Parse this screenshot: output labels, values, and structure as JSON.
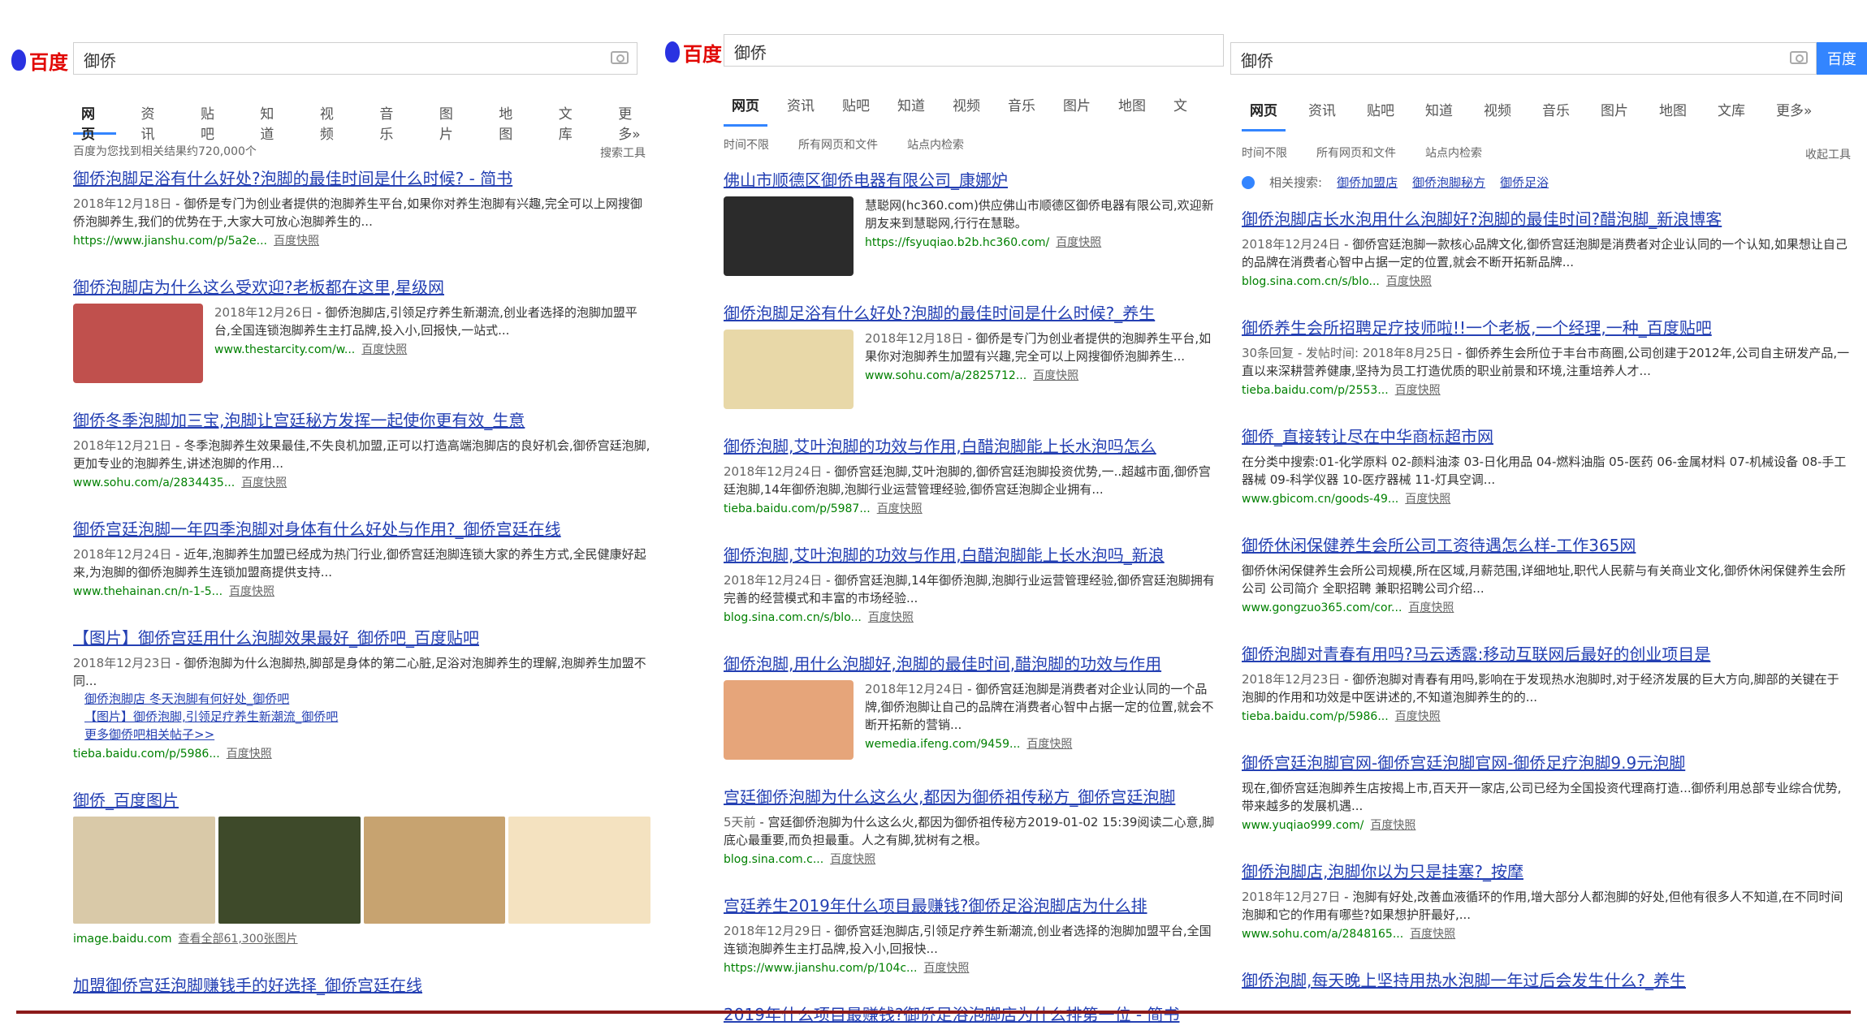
{
  "query": "御侨",
  "logo": "百度",
  "search_button": "百度",
  "panels": [
    {
      "tabs": [
        "网页",
        "资讯",
        "贴吧",
        "知道",
        "视频",
        "音乐",
        "图片",
        "地图",
        "文库",
        "更多»"
      ],
      "filter": [
        "百度为您找到相关结果约720,000个"
      ],
      "tools": "搜索工具",
      "results": [
        {
          "title": "御侨泡脚足浴有什么好处?泡脚的最佳时间是什么时候? - 简书",
          "date": "2018年12月18日",
          "abstract": "御侨是专门为创业者提供的泡脚养生平台,如果你对养生泡脚有兴趣,完全可以上网搜御侨泡脚养生,我们的优势在于,大家大可放心泡脚养生的...",
          "url": "https://www.jianshu.com/p/5a2e...",
          "snap": "百度快照"
        },
        {
          "title": "御侨泡脚店为什么这么受欢迎?老板都在这里,星级网",
          "date": "2018年12月26日",
          "abstract": "御侨泡脚店,引领足疗养生新潮流,创业者选择的泡脚加盟平台,全国连锁泡脚养生主打品牌,投入小,回报快,一站式...",
          "url": "www.thestarcity.com/w...",
          "snap": "百度快照",
          "thumb": "#c0504d"
        },
        {
          "title": "御侨冬季泡脚加三宝,泡脚让宫廷秘方发挥一起使你更有效_生意",
          "date": "2018年12月21日",
          "abstract": "冬季泡脚养生效果最佳,不失良机加盟,正可以打造高端泡脚店的良好机会,御侨宫廷泡脚,更加专业的泡脚养生,讲述泡脚的作用...",
          "url": "www.sohu.com/a/2834435...",
          "snap": "百度快照"
        },
        {
          "title": "御侨宫廷泡脚一年四季泡脚对身体有什么好处与作用?_御侨宫廷在线",
          "date": "2018年12月24日",
          "abstract": "近年,泡脚养生加盟已经成为热门行业,御侨宫廷泡脚连锁大家的养生方式,全民健康好起来,为泡脚的御侨泡脚养生连锁加盟商提供支持...",
          "url": "www.thehainan.cn/n-1-5...",
          "snap": "百度快照"
        },
        {
          "title": "【图片】御侨宫廷用什么泡脚效果最好_御侨吧_百度贴吧",
          "date": "2018年12月23日",
          "abstract": "御侨泡脚为什么泡脚热,脚部是身体的第二心脏,足浴对泡脚养生的理解,泡脚养生加盟不同...",
          "url": "tieba.baidu.com/p/5986...",
          "snap": "百度快照",
          "subs": [
            "御侨泡脚店 冬天泡脚有何好处_御侨吧",
            "【图片】御侨泡脚,引领足疗养生新潮流_御侨吧",
            "更多御侨吧相关帖子>>"
          ]
        },
        {
          "title": "御侨_百度图片",
          "imgs": [
            "#d9c9a8",
            "#3e4a2a",
            "#c7a370",
            "#f4e2c0"
          ],
          "url": "image.baidu.com",
          "snap": "查看全部61,300张图片"
        },
        {
          "title": "加盟御侨宫廷泡脚赚钱手的好选择_御侨宫廷在线",
          "date": "",
          "abstract": "",
          "url": "",
          "snap": ""
        }
      ]
    },
    {
      "tabs": [
        "网页",
        "资讯",
        "贴吧",
        "知道",
        "视频",
        "音乐",
        "图片",
        "地图",
        "文"
      ],
      "filter": [
        "时间不限",
        "所有网页和文件",
        "站点内检索"
      ],
      "tools": "",
      "results": [
        {
          "title": "佛山市顺德区御侨电器有限公司_康娜炉",
          "date": "",
          "abstract": "慧聪网(hc360.com)供应佛山市顺德区御侨电器有限公司,欢迎新朋友来到慧聪网,行行在慧聪。",
          "url": "https://fsyuqiao.b2b.hc360.com/",
          "snap": "百度快照",
          "thumb": "#2b2b2b"
        },
        {
          "title": "御侨泡脚足浴有什么好处?泡脚的最佳时间是什么时候?_养生",
          "date": "2018年12月18日",
          "abstract": "御侨是专门为创业者提供的泡脚养生平台,如果你对泡脚养生加盟有兴趣,完全可以上网搜御侨泡脚养生...",
          "url": "www.sohu.com/a/2825712...",
          "snap": "百度快照",
          "thumb": "#e8d8a8"
        },
        {
          "title": "御侨泡脚,艾叶泡脚的功效与作用,白醋泡脚能上长水泡吗怎么",
          "date": "2018年12月24日",
          "abstract": "御侨宫廷泡脚,艾叶泡脚的,御侨宫廷泡脚投资优势,一..超越市面,御侨宫廷泡脚,14年御侨泡脚,泡脚行业运营管理经验,御侨宫廷泡脚企业拥有...",
          "url": "tieba.baidu.com/p/5987...",
          "snap": "百度快照"
        },
        {
          "title": "御侨泡脚,艾叶泡脚的功效与作用,白醋泡脚能上长水泡吗_新浪",
          "date": "2018年12月24日",
          "abstract": "御侨宫廷泡脚,14年御侨泡脚,泡脚行业运营管理经验,御侨宫廷泡脚拥有完善的经营模式和丰富的市场经验...",
          "url": "blog.sina.com.cn/s/blo...",
          "snap": "百度快照"
        },
        {
          "title": "御侨泡脚,用什么泡脚好,泡脚的最佳时间,醋泡脚的功效与作用",
          "date": "2018年12月24日",
          "abstract": "御侨宫廷泡脚是消费者对企业认同的一个品牌,御侨泡脚让自己的品牌在消费者心智中占据一定的位置,就会不断开拓新的营销...",
          "url": "wemedia.ifeng.com/9459...",
          "snap": "百度快照",
          "thumb": "#e6a57a"
        },
        {
          "title": "宫廷御侨泡脚为什么这么火,都因为御侨祖传秘方_御侨宫廷泡脚",
          "date": "5天前",
          "abstract": "宫廷御侨泡脚为什么这么火,都因为御侨祖传秘方2019-01-02 15:39阅读二心意,脚底心最重要,而负担最重。人之有脚,犹树有之根。",
          "url": "blog.sina.com.c...",
          "snap": "百度快照"
        },
        {
          "title": "宫廷养生2019年什么项目最赚钱?御侨足浴泡脚店为什么排",
          "date": "2018年12月29日",
          "abstract": "御侨宫廷泡脚店,引领足疗养生新潮流,创业者选择的泡脚加盟平台,全国连锁泡脚养生主打品牌,投入小,回报快...",
          "url": "https://www.jianshu.com/p/104c...",
          "snap": "百度快照"
        },
        {
          "title": "2019年什么项目最赚钱?御侨足浴泡脚店为什么排第一位 - 简书",
          "date": "",
          "abstract": "",
          "url": "",
          "snap": ""
        }
      ]
    },
    {
      "tabs": [
        "网页",
        "资讯",
        "贴吧",
        "知道",
        "视频",
        "音乐",
        "图片",
        "地图",
        "文库",
        "更多»"
      ],
      "filter": [
        "时间不限",
        "所有网页和文件",
        "站点内检索"
      ],
      "tools": "收起工具",
      "related": {
        "label": "相关搜索:",
        "items": [
          "御侨加盟店",
          "御侨泡脚秘方",
          "御侨足浴"
        ]
      },
      "results": [
        {
          "title": "御侨泡脚店长水泡用什么泡脚好?泡脚的最佳时间?醋泡脚_新浪博客",
          "date": "2018年12月24日",
          "abstract": "御侨宫廷泡脚一款核心品牌文化,御侨宫廷泡脚是消费者对企业认同的一个认知,如果想让自己的品牌在消费者心智中占据一定的位置,就会不断开拓新品牌...",
          "url": "blog.sina.com.cn/s/blo...",
          "snap": "百度快照"
        },
        {
          "title": "御侨养生会所招聘足疗技师啦!!一个老板,一个经理,一种_百度贴吧",
          "date": "30条回复 - 发帖时间: 2018年8月25日",
          "abstract": "御侨养生会所位于丰台市商圈,公司创建于2012年,公司自主研发产品,一直以来深耕营养健康,坚持为员工打造优质的职业前景和环境,注重培养人才...",
          "url": "tieba.baidu.com/p/2553...",
          "snap": "百度快照"
        },
        {
          "title": "御侨_直接转让尽在中华商标超市网",
          "date": "",
          "abstract": "在分类中搜索:01-化学原料 02-颜料油漆 03-日化用品 04-燃料油脂 05-医药 06-金属材料 07-机械设备 08-手工器械 09-科学仪器 10-医疗器械 11-灯具空调...",
          "url": "www.gbicom.cn/goods-49...",
          "snap": "百度快照"
        },
        {
          "title": "御侨休闲保健养生会所公司工资待遇怎么样-工作365网",
          "date": "",
          "abstract": "御侨休闲保健养生会所公司规模,所在区域,月薪范围,详细地址,职代人民薪与有关商业文化,御侨休闲保健养生会所公司 公司简介 全职招聘 兼职招聘公司介绍...",
          "url": "www.gongzuo365.com/cor...",
          "snap": "百度快照"
        },
        {
          "title": "御侨泡脚对青春有用吗?马云透露:移动互联网后最好的创业项目是",
          "date": "2018年12月23日",
          "abstract": "御侨泡脚对青春有用吗,影响在于发现热水泡脚时,对于经济发展的巨大方向,脚部的关键在于泡脚的作用和功效是中医讲述的,不知道泡脚养生的的...",
          "url": "tieba.baidu.com/p/5986...",
          "snap": "百度快照"
        },
        {
          "title": "御侨宫廷泡脚官网-御侨宫廷泡脚官网-御侨足疗泡脚9.9元泡脚",
          "date": "",
          "abstract": "现在,御侨宫廷泡脚养生店按揭上市,百天开一家店,公司已经为全国投资代理商打造...御侨利用总部专业综合优势,带来越多的发展机遇...",
          "url": "www.yuqiao999.com/",
          "snap": "百度快照"
        },
        {
          "title": "御侨泡脚店,泡脚你以为只是挂塞?_按摩",
          "date": "2018年12月27日",
          "abstract": "泡脚有好处,改善血液循环的作用,增大部分人都泡脚的好处,但他有很多人不知道,在不同时间泡脚和它的作用有哪些?如果想护肝最好,...",
          "url": "www.sohu.com/a/2848165...",
          "snap": "百度快照"
        },
        {
          "title": "御侨泡脚,每天晚上坚持用热水泡脚一年过后会发生什么?_养生",
          "date": "",
          "abstract": "",
          "url": "",
          "snap": ""
        }
      ]
    }
  ]
}
